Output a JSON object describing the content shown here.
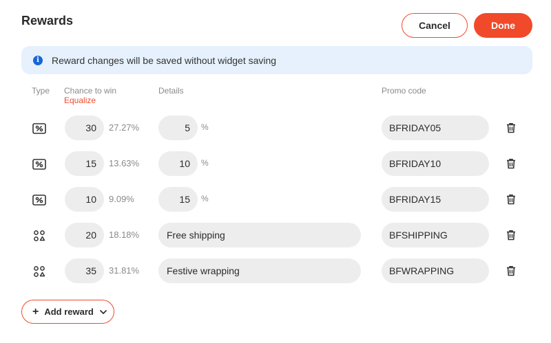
{
  "header": {
    "title": "Rewards",
    "cancel_label": "Cancel",
    "done_label": "Done"
  },
  "banner": {
    "icon": "i",
    "text": "Reward changes will be saved without widget saving"
  },
  "columns": {
    "type": "Type",
    "chance": "Chance to win",
    "equalize": "Equalize",
    "details": "Details",
    "promo": "Promo code"
  },
  "rewards": [
    {
      "type_icon": "discount-icon",
      "chance": "30",
      "percent": "27.27%",
      "detail_value": "5",
      "detail_unit": "%",
      "promo_code": "BFRIDAY05"
    },
    {
      "type_icon": "discount-icon",
      "chance": "15",
      "percent": "13.63%",
      "detail_value": "10",
      "detail_unit": "%",
      "promo_code": "BFRIDAY10"
    },
    {
      "type_icon": "discount-icon",
      "chance": "10",
      "percent": "9.09%",
      "detail_value": "15",
      "detail_unit": "%",
      "promo_code": "BFRIDAY15"
    },
    {
      "type_icon": "other-gift-icon",
      "chance": "20",
      "percent": "18.18%",
      "detail_text": "Free shipping",
      "promo_code": "BFSHIPPING"
    },
    {
      "type_icon": "other-gift-icon",
      "chance": "35",
      "percent": "31.81%",
      "detail_text": "Festive wrapping",
      "promo_code": "BFWRAPPING"
    }
  ],
  "footer": {
    "add_reward_label": "Add reward"
  },
  "colors": {
    "accent": "#f04a2a",
    "banner_bg": "#e6f1fd",
    "info_blue": "#1766d9",
    "field_bg": "#ededed"
  }
}
